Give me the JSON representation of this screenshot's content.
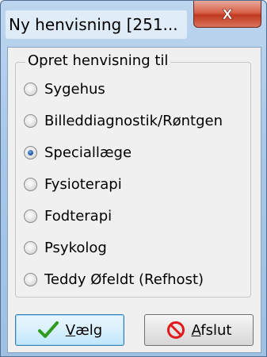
{
  "window": {
    "title": "Ny henvisning [251...",
    "close_glyph": "X"
  },
  "group": {
    "title": "Opret henvisning til"
  },
  "options": [
    {
      "label": "Sygehus",
      "checked": false
    },
    {
      "label": "Billeddiagnostik/Røntgen",
      "checked": false
    },
    {
      "label": "Speciallæge",
      "checked": true
    },
    {
      "label": "Fysioterapi",
      "checked": false
    },
    {
      "label": "Fodterapi",
      "checked": false
    },
    {
      "label": "Psykolog",
      "checked": false
    },
    {
      "label": "Teddy Øfeldt (Refhost)",
      "checked": false
    }
  ],
  "buttons": {
    "select": {
      "mnemonic": "V",
      "rest": "ælg",
      "icon": "checkmark-icon"
    },
    "close": {
      "mnemonic": "A",
      "rest": "fslut",
      "icon": "no-entry-icon"
    }
  },
  "colors": {
    "checkmark": "#2e9b1f",
    "no_entry": "#e21a1a"
  }
}
